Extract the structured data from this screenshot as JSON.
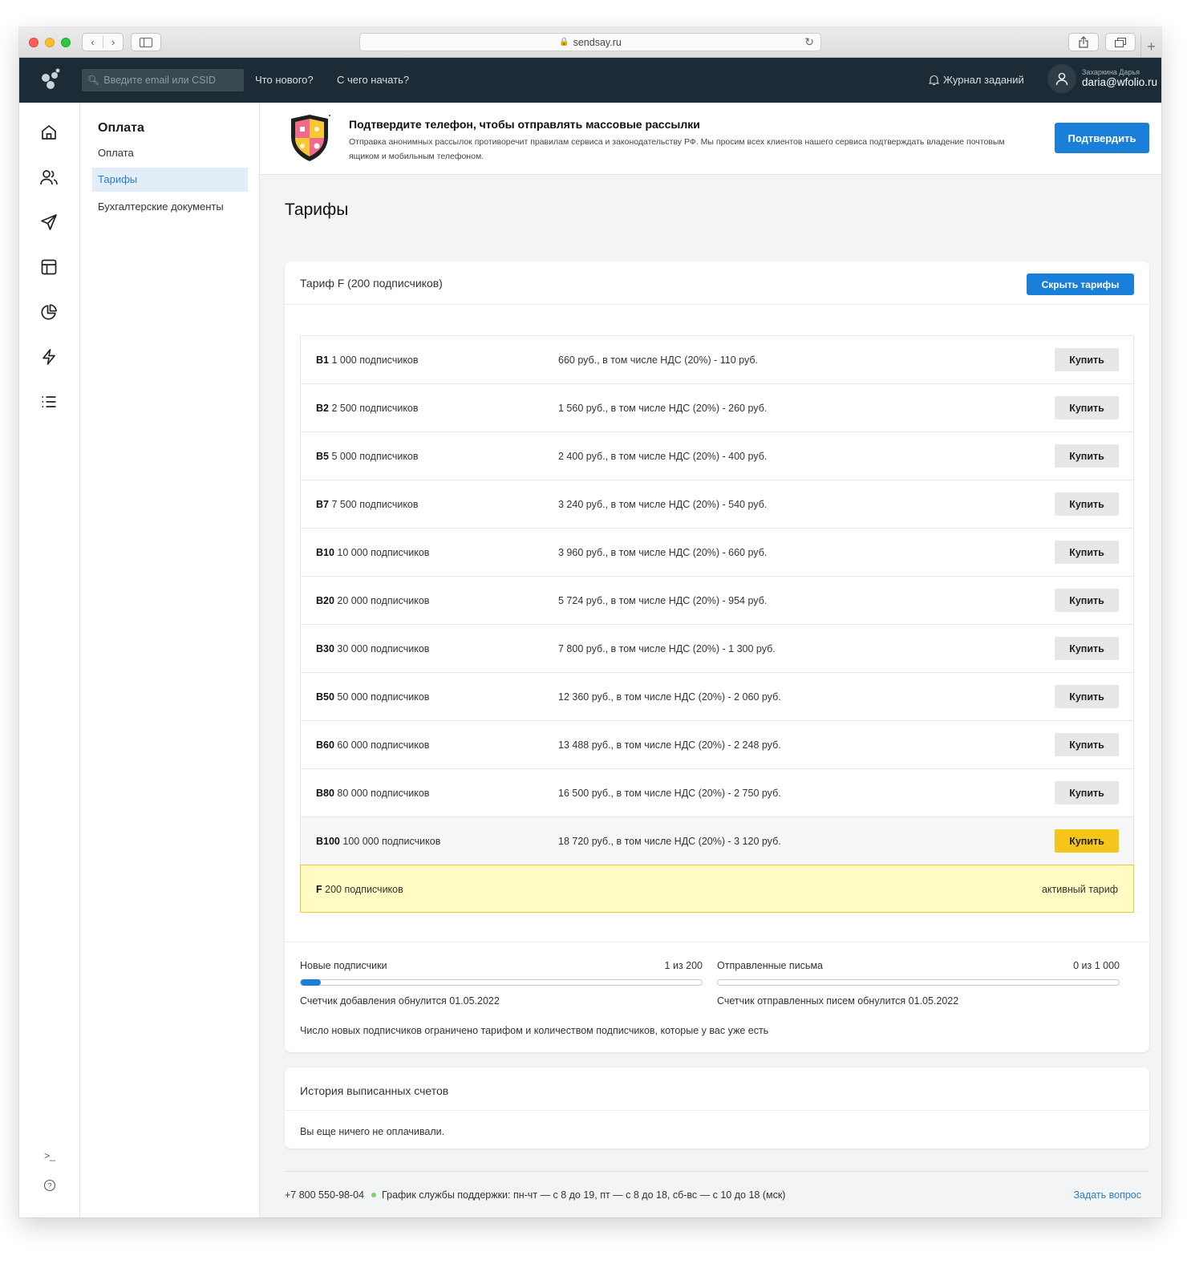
{
  "browser": {
    "url": "sendsay.ru"
  },
  "topbar": {
    "search_placeholder": "Введите email или CSID",
    "whats_new": "Что нового?",
    "get_started": "С чего начать?",
    "journal": "Журнал заданий",
    "user_name": "Захаркина Дарья",
    "user_email": "daria@wfolio.ru"
  },
  "rail": {
    "icons": [
      "home-icon",
      "users-icon",
      "send-icon",
      "layout-icon",
      "pie-chart-icon",
      "lightning-icon",
      "list-icon"
    ],
    "console": ">_",
    "help": "?"
  },
  "subnav": {
    "title": "Оплата",
    "items": [
      {
        "label": "Оплата",
        "active": false
      },
      {
        "label": "Тарифы",
        "active": true
      },
      {
        "label": "Бухгалтерские документы",
        "active": false
      }
    ]
  },
  "banner": {
    "title": "Подтвердите телефон, чтобы отправлять массовые рассылки",
    "text": "Отправка анонимных рассылок противоречит правилам сервиса и законодательству РФ. Мы просим всех клиентов нашего сервиса подтверждать владение почтовым ящиком и мобильным телефоном.",
    "button": "Подтвердить"
  },
  "page_title": "Тарифы",
  "tariff_card": {
    "title": "Тариф F (200 подписчиков)",
    "hide_button": "Скрыть тарифы",
    "plans": [
      {
        "code": "B1",
        "subscribers": "1 000 подписчиков",
        "price": "660 руб., в том числе НДС (20%) - 110 руб.",
        "buy": "Купить"
      },
      {
        "code": "B2",
        "subscribers": "2 500 подписчиков",
        "price": "1 560 руб., в том числе НДС (20%) - 260 руб.",
        "buy": "Купить"
      },
      {
        "code": "B5",
        "subscribers": "5 000 подписчиков",
        "price": "2 400 руб., в том числе НДС (20%) - 400 руб.",
        "buy": "Купить"
      },
      {
        "code": "B7",
        "subscribers": "7 500 подписчиков",
        "price": "3 240 руб., в том числе НДС (20%) - 540 руб.",
        "buy": "Купить"
      },
      {
        "code": "B10",
        "subscribers": "10 000 подписчиков",
        "price": "3 960 руб., в том числе НДС (20%) - 660 руб.",
        "buy": "Купить"
      },
      {
        "code": "B20",
        "subscribers": "20 000 подписчиков",
        "price": "5 724 руб., в том числе НДС (20%) - 954 руб.",
        "buy": "Купить"
      },
      {
        "code": "B30",
        "subscribers": "30 000 подписчиков",
        "price": "7 800 руб., в том числе НДС (20%) - 1 300 руб.",
        "buy": "Купить"
      },
      {
        "code": "B50",
        "subscribers": "50 000 подписчиков",
        "price": "12 360 руб., в том числе НДС (20%) - 2 060 руб.",
        "buy": "Купить"
      },
      {
        "code": "B60",
        "subscribers": "60 000 подписчиков",
        "price": "13 488 руб., в том числе НДС (20%) - 2 248 руб.",
        "buy": "Купить"
      },
      {
        "code": "B80",
        "subscribers": "80 000 подписчиков",
        "price": "16 500 руб., в том числе НДС (20%) - 2 750 руб.",
        "buy": "Купить"
      },
      {
        "code": "B100",
        "subscribers": "100 000 подписчиков",
        "price": "18 720 руб., в том числе НДС (20%) - 3 120 руб.",
        "buy": "Купить"
      }
    ],
    "active_plan": {
      "code": "F",
      "subscribers": "200 подписчиков",
      "label": "активный тариф"
    },
    "usage": {
      "new_subscribers": {
        "label": "Новые подписчики",
        "count": "1 из 200",
        "fill": 0.05,
        "note": "Счетчик добавления обнулится 01.05.2022"
      },
      "sent_letters": {
        "label": "Отправленные письма",
        "count": "0 из 1 000",
        "fill": 0,
        "note": "Счетчик отправленных писем обнулится 01.05.2022"
      },
      "footnote": "Число новых подписчиков ограничено тарифом и количеством подписчиков, которые у вас уже есть"
    }
  },
  "history": {
    "title": "История выписанных счетов",
    "empty": "Вы еще ничего не оплачивали."
  },
  "footer": {
    "phone": "+7 800 550-98-04",
    "schedule": "График службы поддержки: пн-чт — с 8 до 19, пт — с 8 до 18, сб-вс — с 10 до 18 (мск)",
    "ask": "Задать вопрос"
  },
  "colors": {
    "topbar": "#1c2b36",
    "primary": "#1a7fd8",
    "highlight_buy": "#f6c51a",
    "active_plan_bg": "#fffbc2",
    "status_dot": "#7fd06b"
  }
}
